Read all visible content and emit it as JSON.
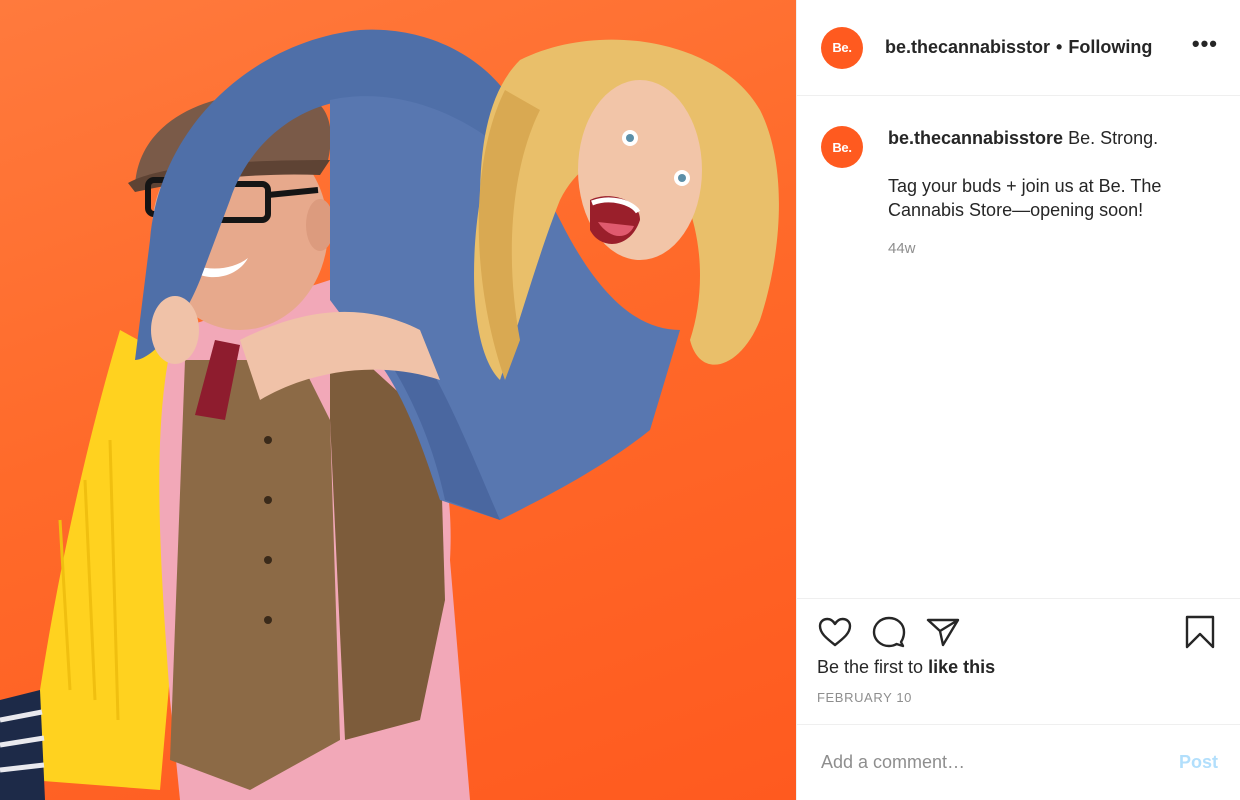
{
  "post": {
    "brand_initials": "Be.",
    "header": {
      "username": "be.thecannabisstor",
      "separator": "•",
      "follow_label": "Following",
      "more_label": "•••"
    },
    "caption": {
      "username": "be.thecannabisstore",
      "text_line1": "Be. Strong.",
      "text_line2": "Tag your buds + join us at Be. The Cannabis Store—opening soon!",
      "time": "44w"
    },
    "actions": {
      "icons": [
        "heart-icon",
        "comment-icon",
        "share-icon",
        "bookmark-icon"
      ],
      "likes_prefix": "Be the first to ",
      "likes_link": "like this",
      "date": "FEBRUARY 10"
    },
    "comment_box": {
      "placeholder": "Add a comment…",
      "post_label": "Post"
    }
  },
  "colors": {
    "brand_orange": "#ff5a1f",
    "text": "#262626",
    "muted": "#8e8e8e",
    "post_disabled": "#b2dffc"
  }
}
